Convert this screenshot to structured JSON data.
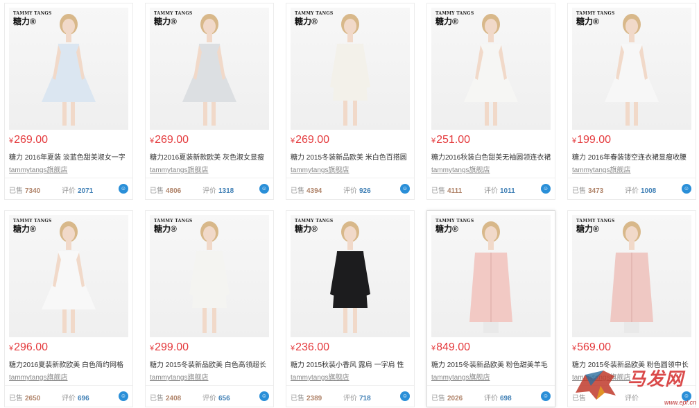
{
  "products": [
    {
      "price": "269.00",
      "title": "糖力 2016年夏装 淡蓝色甜美淑女一字",
      "shop": "tammytangs旗舰店",
      "sold_label": "已售",
      "sold": "7340",
      "review_label": "评价",
      "reviews": "2071",
      "dress": "#dbe6f1",
      "dress_type": "a-line",
      "logo_en": "TAMMY TANGS",
      "logo_cn": "糖力®"
    },
    {
      "price": "269.00",
      "title": "糖力2016夏装新款欧美 灰色淑女显瘦",
      "shop": "tammytangs旗舰店",
      "sold_label": "已售",
      "sold": "4806",
      "review_label": "评价",
      "reviews": "1318",
      "dress": "#dcdfe2",
      "dress_type": "a-line",
      "logo_en": "TAMMY TANGS",
      "logo_cn": "糖力®"
    },
    {
      "price": "269.00",
      "title": "糖力 2015冬装新品欧美 米白色百搭圆",
      "shop": "tammytangs旗舰店",
      "sold_label": "已售",
      "sold": "4394",
      "review_label": "评价",
      "reviews": "926",
      "dress": "#f3f1ea",
      "dress_type": "sleeve",
      "logo_en": "TAMMY TANGS",
      "logo_cn": "糖力®"
    },
    {
      "price": "251.00",
      "title": "糖力2016秋装白色甜美无袖圆领连衣裙",
      "shop": "tammytangs旗舰店",
      "sold_label": "已售",
      "sold": "4111",
      "review_label": "评价",
      "reviews": "1011",
      "dress": "#f6f6f4",
      "dress_type": "a-line",
      "logo_en": "TAMMY TANGS",
      "logo_cn": "糖力®"
    },
    {
      "price": "199.00",
      "title": "糖力 2016年春装镂空连衣裙显瘦收腰",
      "shop": "tammytangs旗舰店",
      "sold_label": "已售",
      "sold": "3473",
      "review_label": "评价",
      "reviews": "1008",
      "dress": "#f7f7f7",
      "dress_type": "a-line",
      "logo_en": "TAMMY TANGS",
      "logo_cn": "糖力®"
    },
    {
      "price": "296.00",
      "title": "糖力2016夏装新款欧美 白色简约网格",
      "shop": "tammytangs旗舰店",
      "sold_label": "已售",
      "sold": "2650",
      "review_label": "评价",
      "reviews": "696",
      "dress": "#f8f8f8",
      "dress_type": "a-line",
      "logo_en": "TAMMY TANGS",
      "logo_cn": "糖力®"
    },
    {
      "price": "299.00",
      "title": "糖力 2015冬装新品欧美 白色高领超长",
      "shop": "tammytangs旗舰店",
      "sold_label": "已售",
      "sold": "2408",
      "review_label": "评价",
      "reviews": "656",
      "dress": "#f4f4f1",
      "dress_type": "sleeve",
      "logo_en": "TAMMY TANGS",
      "logo_cn": "糖力®"
    },
    {
      "price": "236.00",
      "title": "糖力 2015秋装小香风 露肩 一字肩 性",
      "shop": "tammytangs旗舰店",
      "sold_label": "已售",
      "sold": "2389",
      "review_label": "评价",
      "reviews": "718",
      "dress": "#1c1c1e",
      "dress_type": "sleeve",
      "logo_en": "TAMMY TANGS",
      "logo_cn": "糖力®"
    },
    {
      "price": "849.00",
      "title": "糖力 2015冬装新品欧美 粉色甜美羊毛",
      "shop": "tammytangs旗舰店",
      "sold_label": "已售",
      "sold": "2026",
      "review_label": "评价",
      "reviews": "698",
      "dress": "#f2c9c4",
      "dress_type": "coat",
      "logo_en": "TAMMY TANGS",
      "logo_cn": "糖力®"
    },
    {
      "price": "569.00",
      "title": "糖力 2015冬装新品欧美 粉色圆领中长",
      "shop": "tammytangs旗舰店",
      "sold_label": "已售",
      "sold": "",
      "review_label": "评价",
      "reviews": "",
      "dress": "#efc8c3",
      "dress_type": "coat",
      "logo_en": "TAMMY TANGS",
      "logo_cn": "糖力®"
    }
  ],
  "currency": "¥",
  "watermark": {
    "text": "马发网",
    "url": "www.epf.cn"
  }
}
